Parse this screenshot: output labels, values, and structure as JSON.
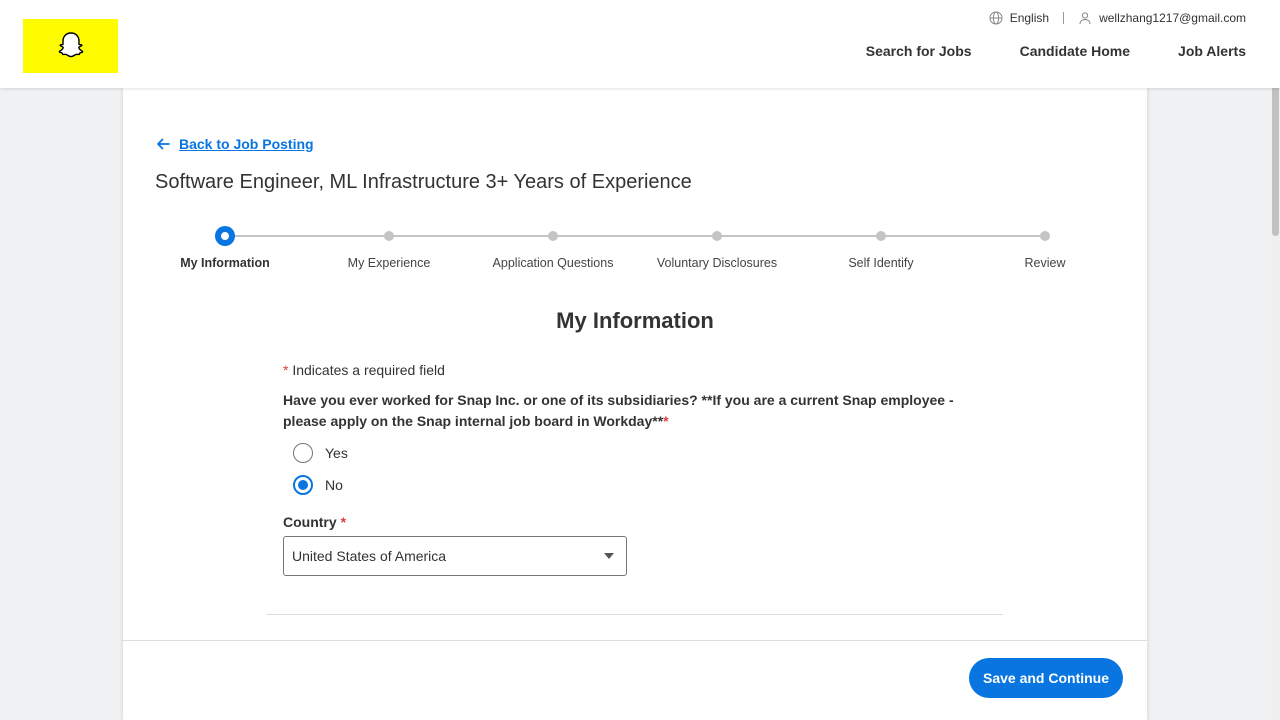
{
  "header": {
    "language": "English",
    "user_email": "wellzhang1217@gmail.com",
    "nav": [
      "Search for Jobs",
      "Candidate Home",
      "Job Alerts"
    ],
    "logo_color": "#fffc00"
  },
  "page": {
    "back_link": "Back to Job Posting",
    "job_title": "Software Engineer, ML Infrastructure 3+ Years of Experience",
    "section_title": "My Information"
  },
  "steps": [
    {
      "label": "My Information",
      "active": true
    },
    {
      "label": "My Experience",
      "active": false
    },
    {
      "label": "Application Questions",
      "active": false
    },
    {
      "label": "Voluntary Disclosures",
      "active": false
    },
    {
      "label": "Self Identify",
      "active": false
    },
    {
      "label": "Review",
      "active": false
    }
  ],
  "form": {
    "required_note": "Indicates a required field",
    "question": "Have you ever worked for Snap Inc. or one of its subsidiaries? **If you are a current Snap employee - please apply on the Snap internal job board in Workday**",
    "options": [
      "Yes",
      "No"
    ],
    "selected_option": "No",
    "country_label": "Country",
    "country_value": "United States of America"
  },
  "footer": {
    "save_label": "Save and Continue"
  },
  "colors": {
    "accent": "#0875e1",
    "required": "#de3e3e"
  }
}
